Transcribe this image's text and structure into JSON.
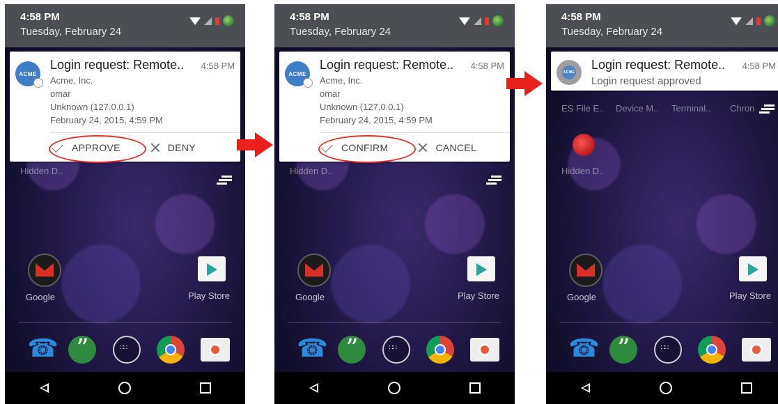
{
  "colors": {
    "status_bar": "#4b4e52",
    "annotation_red": "#e8211c",
    "acme_blue": "#3d7ec6"
  },
  "screens": [
    {
      "status": {
        "time": "4:58 PM",
        "date": "Tuesday, February 24"
      },
      "notification": {
        "app_icon_text": "ACME",
        "title": "Login request: Remote..",
        "time": "4:58 PM",
        "company": "Acme, Inc.",
        "user": "omar",
        "location": "Unknown (127.0.0.1)",
        "datetime": "February 24, 2015, 4:59 PM",
        "action_primary": "APPROVE",
        "action_secondary": "DENY"
      },
      "home": {
        "hidden_label": "Hidden D..",
        "google_label": "Google",
        "playstore_label": "Play Store"
      }
    },
    {
      "status": {
        "time": "4:58 PM",
        "date": "Tuesday, February 24"
      },
      "notification": {
        "app_icon_text": "ACME",
        "title": "Login request: Remote..",
        "time": "4:58 PM",
        "company": "Acme, Inc.",
        "user": "omar",
        "location": "Unknown (127.0.0.1)",
        "datetime": "February 24, 2015, 4:59 PM",
        "action_primary": "CONFIRM",
        "action_secondary": "CANCEL"
      },
      "home": {
        "hidden_label": "Hidden D..",
        "google_label": "Google",
        "playstore_label": "Play Store"
      }
    },
    {
      "status": {
        "time": "4:58 PM",
        "date": "Tuesday, February 24"
      },
      "notification": {
        "app_icon_text": "ACME",
        "title": "Login request: Remote..",
        "time": "4:58 PM",
        "subtitle": "Login request approved"
      },
      "home": {
        "app_labels": [
          "ES File E..",
          "Device M..",
          "Terminal..",
          "Chron"
        ],
        "hidden_label": "Hidden D..",
        "google_label": "Google",
        "playstore_label": "Play Store"
      }
    }
  ],
  "icons": {
    "status": [
      "wifi-icon",
      "signal-icon",
      "battery-icon",
      "avatar-icon"
    ],
    "dock": [
      "phone-icon",
      "hangouts-icon",
      "app-drawer-icon",
      "chrome-icon",
      "camera-icon"
    ],
    "nav": [
      "back-icon",
      "home-icon",
      "recents-icon"
    ]
  }
}
